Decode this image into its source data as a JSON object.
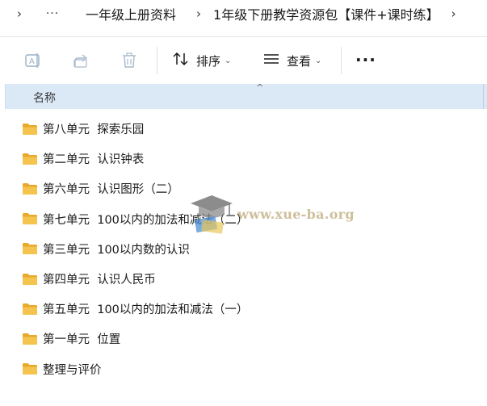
{
  "breadcrumb": {
    "more_label": "···",
    "items": [
      {
        "label": "一年级上册资料"
      },
      {
        "label": "1年级下册教学资源包【课件+课时练】"
      }
    ]
  },
  "toolbar": {
    "sort_label": "排序",
    "view_label": "查看",
    "more_label": "···",
    "icons": [
      "rename-icon",
      "share-icon",
      "delete-icon",
      "sort-icon",
      "view-icon"
    ]
  },
  "column_header": {
    "name_label": "名称",
    "sort_indicator": "^"
  },
  "files": [
    {
      "label": "第八单元  探索乐园",
      "type": "folder"
    },
    {
      "label": "第二单元  认识钟表",
      "type": "folder"
    },
    {
      "label": "第六单元  认识图形（二）",
      "type": "folder"
    },
    {
      "label": "第七单元  100以内的加法和减法（二）",
      "type": "folder"
    },
    {
      "label": "第三单元  100以内数的认识",
      "type": "folder"
    },
    {
      "label": "第四单元  认识人民币",
      "type": "folder"
    },
    {
      "label": "第五单元  100以内的加法和减法（一）",
      "type": "folder"
    },
    {
      "label": "第一单元  位置",
      "type": "folder"
    },
    {
      "label": "整理与评价",
      "type": "folder"
    }
  ],
  "watermark": {
    "text": "www.xue-ba.org"
  },
  "colors": {
    "folder": "#f5c44e",
    "folder_dark": "#e8a92c",
    "header_bg": "#dbe9f7",
    "accent": "#0067c0"
  }
}
